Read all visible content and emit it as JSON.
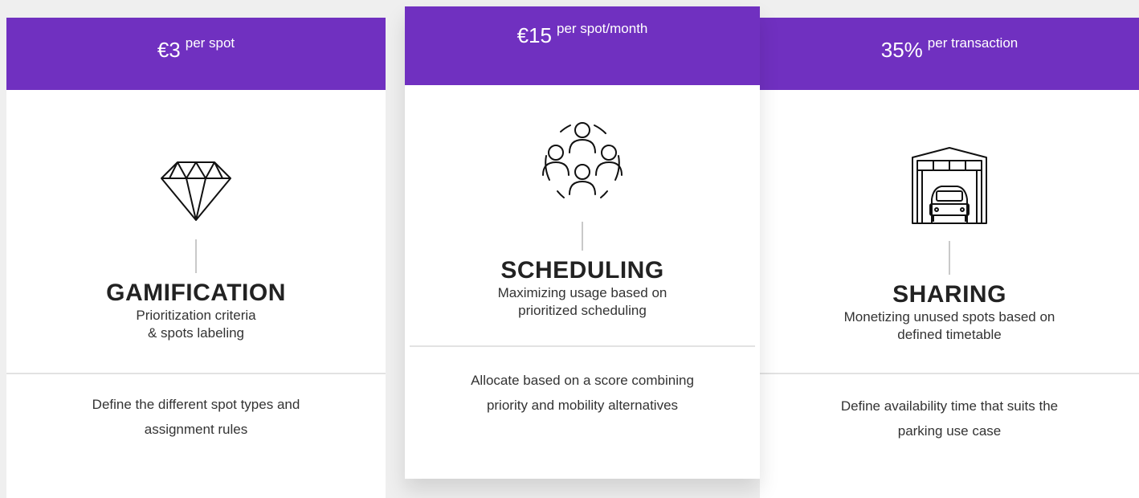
{
  "plans": [
    {
      "price": "€3",
      "unit": "per spot",
      "icon": "diamond-icon",
      "title": "GAMIFICATION",
      "subtitle_lines": [
        "Prioritization criteria",
        "& spots labeling"
      ],
      "desc_lines": [
        "Define the different spot types and",
        "assignment rules"
      ]
    },
    {
      "price": "€15",
      "unit": "per spot/month",
      "icon": "people-network-icon",
      "title": "SCHEDULING",
      "subtitle_lines": [
        "Maximizing usage based on",
        "prioritized scheduling"
      ],
      "desc_lines": [
        "Allocate based on a score combining",
        "priority and mobility alternatives"
      ]
    },
    {
      "price": "35%",
      "unit": "per transaction",
      "icon": "garage-car-icon",
      "title": "SHARING",
      "subtitle_lines": [
        "Monetizing unused spots based on",
        "defined timetable"
      ],
      "desc_lines": [
        "Define availability time that suits the",
        "parking use case"
      ]
    }
  ],
  "colors": {
    "accent": "#7030c0",
    "background": "#efefef",
    "card": "#ffffff"
  }
}
